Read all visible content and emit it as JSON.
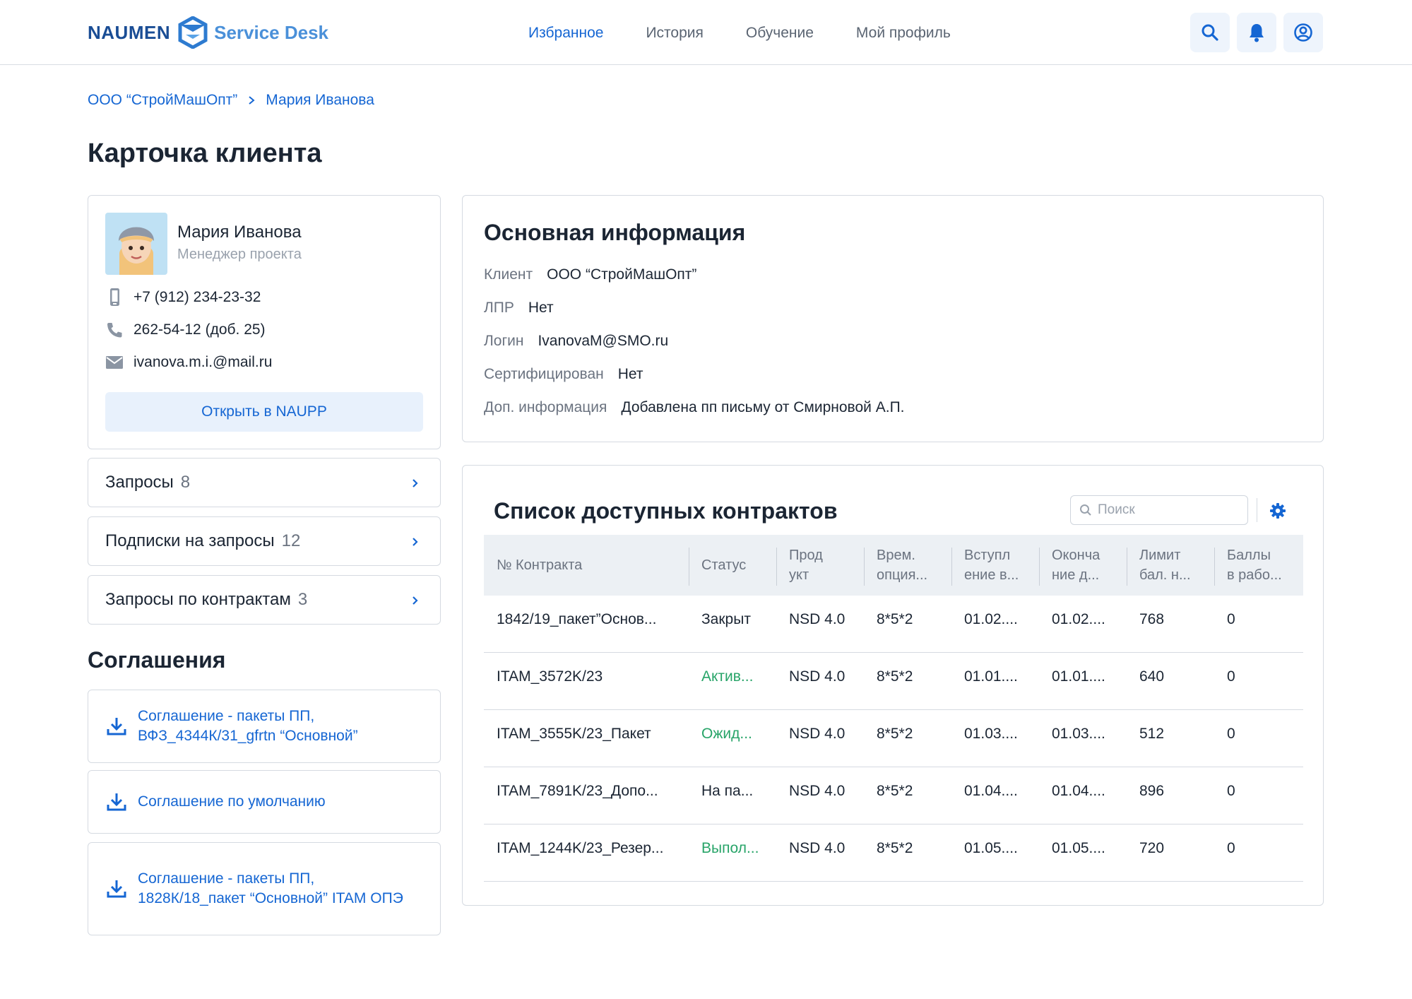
{
  "header": {
    "logo_brand": "NAUMEN",
    "logo_product": "Service Desk",
    "nav": [
      "Избранное",
      "История",
      "Обучение",
      "Мой профиль"
    ],
    "active_nav": "Избранное"
  },
  "breadcrumb": [
    "ООО “СтройМашОпт”",
    "Мария Иванова"
  ],
  "page_title": "Карточка клиента",
  "profile": {
    "name": "Мария Иванова",
    "role": "Менеджер проекта",
    "mobile": "+7 (912) 234-23-32",
    "phone": "262-54-12 (доб. 25)",
    "email": "ivanova.m.i.@mail.ru",
    "open_button": "Открыть в NAUPP"
  },
  "links": [
    {
      "label": "Запросы",
      "count": "8"
    },
    {
      "label": "Подписки на запросы",
      "count": "12"
    },
    {
      "label": "Запросы по контрактам",
      "count": "3"
    }
  ],
  "agreements": {
    "title": "Соглашения",
    "items": [
      "Соглашение - пакеты ПП, ВФЗ_4344К/31_gfrtn “Основной”",
      "Соглашение по умолчанию",
      "Соглашение - пакеты ПП, 1828К/18_пакет “Основной” ITAM ОПЭ"
    ]
  },
  "main_info": {
    "title": "Основная информация",
    "rows": [
      {
        "key": "Клиент",
        "value": "ООО “СтройМашОпт”"
      },
      {
        "key": "ЛПР",
        "value": "Нет"
      },
      {
        "key": "Логин",
        "value": "IvanovaM@SMO.ru"
      },
      {
        "key": "Сертифицирован",
        "value": "Нет"
      },
      {
        "key": "Доп. информация",
        "value": "Добавлена пп письму от Смирновой А.П."
      }
    ]
  },
  "contracts": {
    "title": "Список доступных контрактов",
    "search_placeholder": "Поиск",
    "columns": [
      [
        "№ Контракта"
      ],
      [
        "Статус"
      ],
      [
        "Прод",
        "укт"
      ],
      [
        "Врем.",
        "опция..."
      ],
      [
        "Вступл",
        "ение в..."
      ],
      [
        "Оконча",
        "ние д..."
      ],
      [
        "Лимит",
        "бал. н..."
      ],
      [
        "Баллы",
        "в рабо..."
      ]
    ],
    "rows": [
      [
        "1842/19_пакет”Основ...",
        "Закрыт",
        "NSD 4.0",
        "8*5*2",
        "01.02....",
        "01.02....",
        "768",
        "0"
      ],
      [
        "ITAM_3572K/23",
        "Актив...",
        "NSD 4.0",
        "8*5*2",
        "01.01....",
        "01.01....",
        "640",
        "0"
      ],
      [
        "ITAM_3555K/23_Пакет",
        "Ожид...",
        "NSD 4.0",
        "8*5*2",
        "01.03....",
        "01.03....",
        "512",
        "0"
      ],
      [
        "ITAM_7891K/23_Допо...",
        "На па...",
        "NSD 4.0",
        "8*5*2",
        "01.04....",
        "01.04....",
        "896",
        "0"
      ],
      [
        "ITAM_1244K/23_Резер...",
        "Выпол...",
        "NSD 4.0",
        "8*5*2",
        "01.05....",
        "01.05....",
        "720",
        "0"
      ]
    ],
    "status_colors": [
      "#1b2533",
      "#27a468",
      "#27a468",
      "#1b2533",
      "#27a468"
    ]
  },
  "colors": {
    "accent": "#1566d3",
    "success": "#27a468",
    "brand_dark": "#1a4d95"
  }
}
